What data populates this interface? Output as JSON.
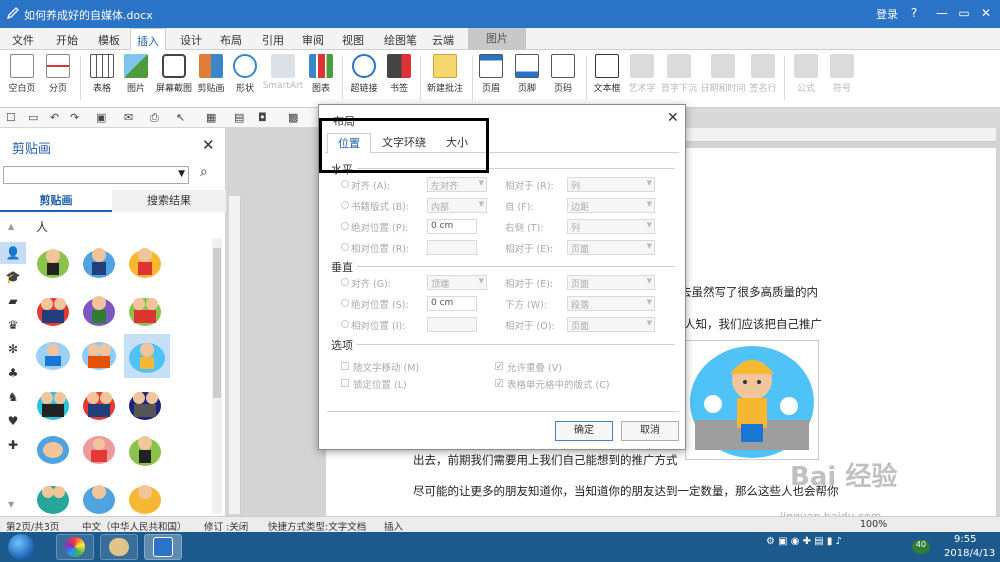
{
  "titlebar": {
    "doc_name": "如何养成好的自媒体.docx",
    "login": "登录",
    "help": "?",
    "minimize": "—",
    "restore": "▭",
    "close": "✕"
  },
  "menu": {
    "tabs": [
      "文件",
      "开始",
      "模板",
      "插入",
      "设计",
      "布局",
      "引用",
      "审阅",
      "视图",
      "绘图笔",
      "云端"
    ],
    "active": "插入",
    "picture_tab": "图片"
  },
  "ribbon": {
    "items": [
      {
        "label": "空白页",
        "enabled": true
      },
      {
        "label": "分页",
        "enabled": true
      },
      {
        "label": "表格",
        "enabled": true
      },
      {
        "label": "图片",
        "enabled": true
      },
      {
        "label": "屏幕截图",
        "enabled": true
      },
      {
        "label": "剪贴画",
        "enabled": true
      },
      {
        "label": "形状",
        "enabled": true
      },
      {
        "label": "SmartArt",
        "enabled": false
      },
      {
        "label": "图表",
        "enabled": true
      },
      {
        "label": "超链接",
        "enabled": true
      },
      {
        "label": "书签",
        "enabled": true
      },
      {
        "label": "新建批注",
        "enabled": true
      },
      {
        "label": "页眉",
        "enabled": true
      },
      {
        "label": "页脚",
        "enabled": true
      },
      {
        "label": "页码",
        "enabled": true
      },
      {
        "label": "文本框",
        "enabled": true
      },
      {
        "label": "艺术字",
        "enabled": false
      },
      {
        "label": "首字下沉",
        "enabled": false
      },
      {
        "label": "日期和时间",
        "enabled": false
      },
      {
        "label": "签名行",
        "enabled": false
      },
      {
        "label": "公式",
        "enabled": false
      },
      {
        "label": "符号",
        "enabled": false
      }
    ]
  },
  "clipart_panel": {
    "title": "剪贴画",
    "close": "✕",
    "tab_clipart": "剪贴画",
    "tab_results": "搜索结果",
    "category_label": "人"
  },
  "document": {
    "lines": [
      "去虽然写了很多高质量的内",
      "人知，我们应该把自己推广",
      "出去，前期我们需要用上我们自己能想到的推广方式",
      "尽可能的让更多的朋友知道你，当知道你的朋友达到一定数量，那么这些人也会帮你"
    ]
  },
  "dialog": {
    "title": "布局",
    "close": "✕",
    "tabs": [
      "位置",
      "文字环绕",
      "大小"
    ],
    "active_tab": "位置",
    "horizontal": {
      "section": "水平",
      "align_label": "对齐 (A):",
      "align_value": "左对齐",
      "relative1_label": "相对于 (R):",
      "relative1_value": "列",
      "book_label": "书籍版式 (B):",
      "book_value": "内部",
      "of_label": "自 (F):",
      "of_value": "边距",
      "absolute_label": "绝对位置 (P):",
      "absolute_value": "0 cm",
      "right_label": "右侧 (T):",
      "right_value": "列",
      "relative_label": "相对位置 (R):",
      "relative2_label": "相对于 (E):",
      "relative2_value": "页面"
    },
    "vertical": {
      "section": "垂直",
      "align_label": "对齐 (G):",
      "align_value": "顶端",
      "relative1_label": "相对于 (E):",
      "relative1_value": "页面",
      "absolute_label": "绝对位置 (S):",
      "absolute_value": "0 cm",
      "below_label": "下方 (W):",
      "below_value": "段落",
      "relative_label": "相对位置 (I):",
      "relative2_label": "相对于 (O):",
      "relative2_value": "页面"
    },
    "options": {
      "section": "选项",
      "move_with_text": "随文字移动 (M)",
      "allow_overlap": "允许重叠 (V)",
      "lock_anchor": "锁定位置 (L)",
      "layout_in_cell": "表格单元格中的版式 (C)"
    },
    "ok": "确定",
    "cancel": "取消"
  },
  "statusbar": {
    "page": "第2页/共3页",
    "language": "中文（中华人民共和国）",
    "track": "修订 :关闭",
    "shortcut": "快捷方式类型:文字文档",
    "mode": "插入",
    "zoom": "100%"
  },
  "taskbar": {
    "time": "9:55",
    "date": "2018/4/13",
    "badge": "40"
  },
  "watermark": {
    "main": "Bai 经验",
    "sub": "jingyan.baidu.com"
  }
}
